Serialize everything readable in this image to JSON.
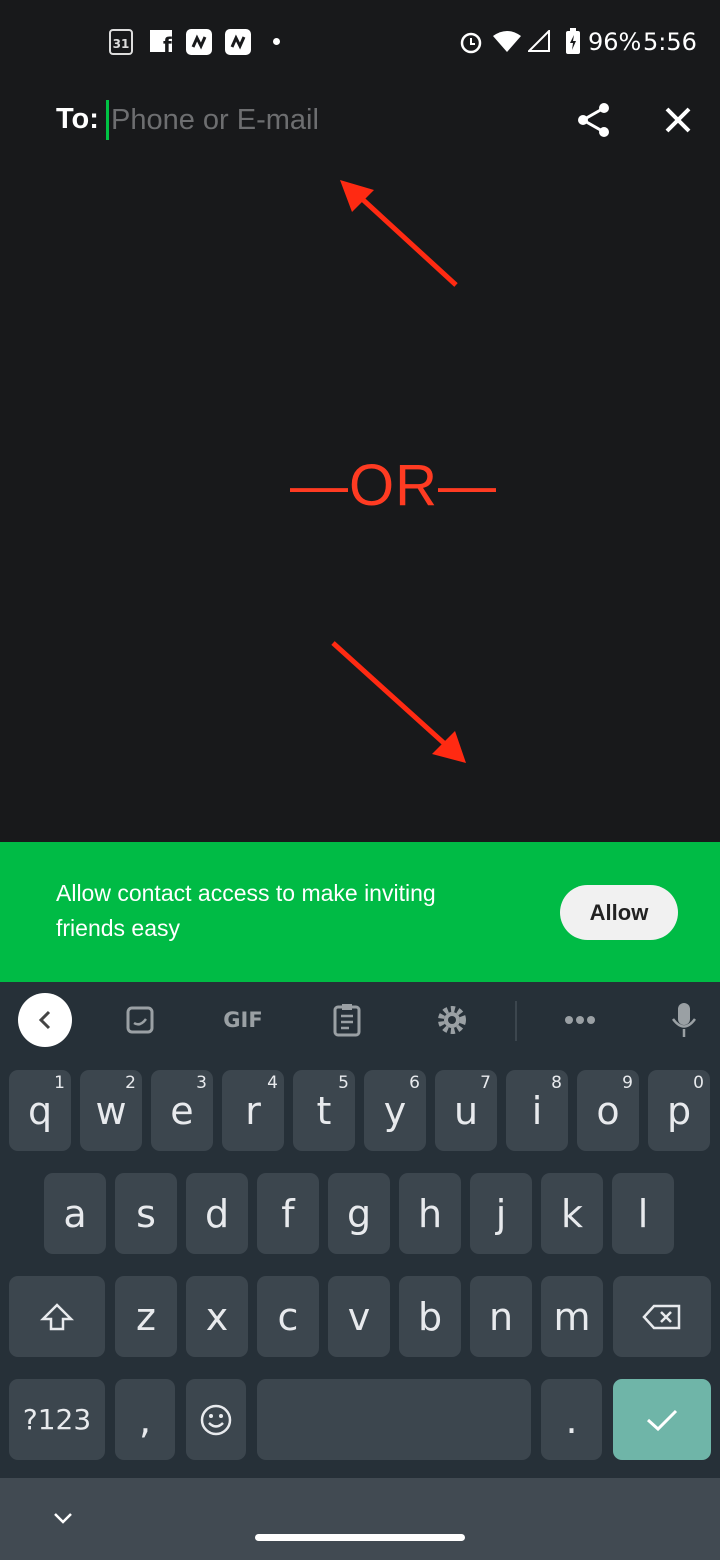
{
  "status_bar": {
    "battery": "96%",
    "time": "5:56",
    "calendar_day": "31",
    "icons": [
      "calendar-icon",
      "facebook-icon",
      "app-icon",
      "app-icon",
      "dot-icon",
      "alarm-icon",
      "wifi-icon",
      "signal-icon",
      "battery-charging-icon"
    ]
  },
  "header": {
    "to_label": "To:",
    "input_placeholder": "Phone or E-mail",
    "input_value": "",
    "share_icon": "share-icon",
    "close_icon": "close-icon"
  },
  "annotation": {
    "or_text": "—OR—",
    "color": "#ff3b22"
  },
  "banner": {
    "text": "Allow contact access to make inviting friends easy",
    "allow_label": "Allow",
    "color": "#00bb45"
  },
  "keyboard": {
    "toolbar": {
      "gif_label": "GIF"
    },
    "row1": [
      {
        "k": "q",
        "h": "1"
      },
      {
        "k": "w",
        "h": "2"
      },
      {
        "k": "e",
        "h": "3"
      },
      {
        "k": "r",
        "h": "4"
      },
      {
        "k": "t",
        "h": "5"
      },
      {
        "k": "y",
        "h": "6"
      },
      {
        "k": "u",
        "h": "7"
      },
      {
        "k": "i",
        "h": "8"
      },
      {
        "k": "o",
        "h": "9"
      },
      {
        "k": "p",
        "h": "0"
      }
    ],
    "row2": [
      "a",
      "s",
      "d",
      "f",
      "g",
      "h",
      "j",
      "k",
      "l"
    ],
    "row3": [
      "z",
      "x",
      "c",
      "v",
      "b",
      "n",
      "m"
    ],
    "symbols_label": "?123",
    "comma": ",",
    "period": ".",
    "enter_color": "#6fb5a8"
  }
}
